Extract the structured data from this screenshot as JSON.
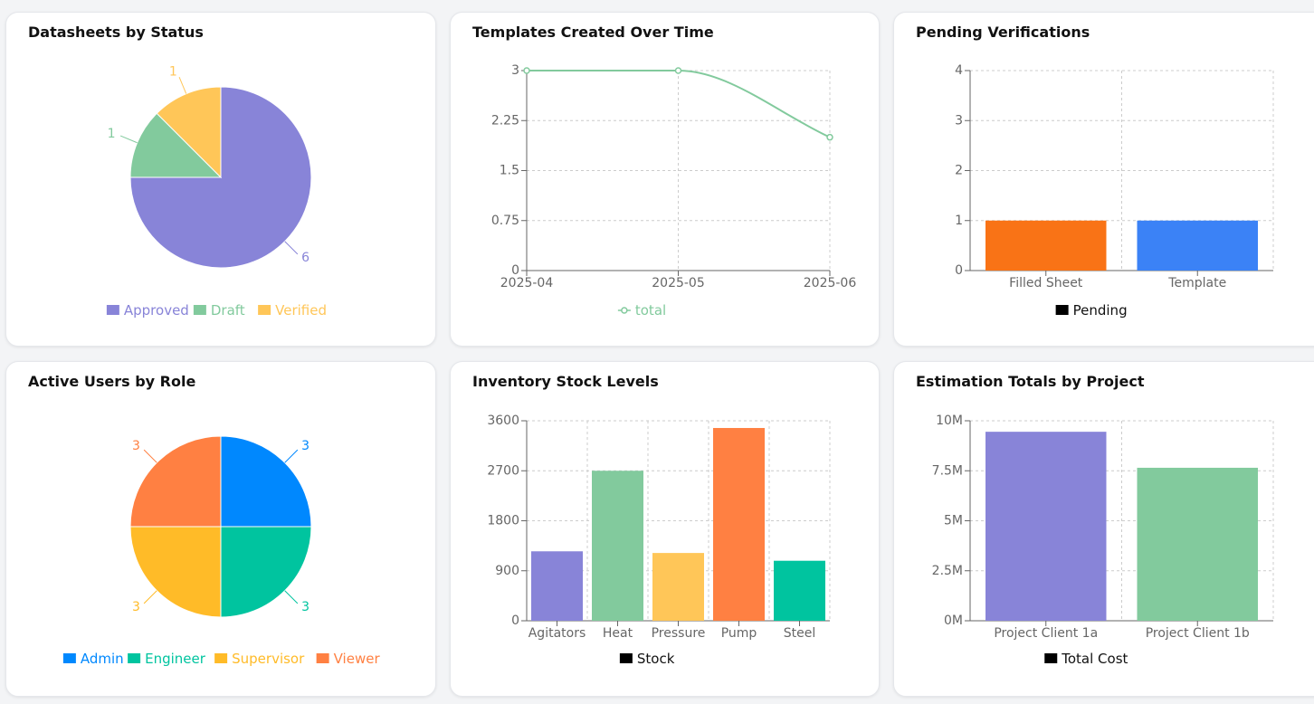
{
  "charts": [
    {
      "title": "Datasheets by Status",
      "chart_data": {
        "type": "pie",
        "labels": [
          "Approved",
          "Draft",
          "Verified"
        ],
        "values": [
          6,
          1,
          1
        ],
        "colors": [
          "#8884d8",
          "#82ca9d",
          "#ffc658"
        ],
        "legend": "bottom"
      }
    },
    {
      "title": "Templates Created Over Time",
      "chart_data": {
        "type": "line",
        "x": [
          "2025-04",
          "2025-05",
          "2025-06"
        ],
        "series": [
          {
            "name": "total",
            "values": [
              3,
              3,
              2
            ],
            "color": "#82ca9d"
          }
        ],
        "yticks": [
          "0",
          "0.75",
          "1.5",
          "2.25",
          "3"
        ],
        "ylim": [
          0,
          3
        ],
        "grid": true,
        "legend": "bottom"
      }
    },
    {
      "title": "Pending Verifications",
      "chart_data": {
        "type": "bar",
        "categories": [
          "Filled Sheet",
          "Template"
        ],
        "series": [
          {
            "name": "Pending",
            "values": [
              1,
              1
            ]
          }
        ],
        "colors": [
          "#f97316",
          "#3b82f6"
        ],
        "yticks": [
          "0",
          "1",
          "2",
          "3",
          "4"
        ],
        "ylim": [
          0,
          4
        ],
        "grid": true,
        "legend": "bottom"
      }
    },
    {
      "title": "Active Users by Role",
      "chart_data": {
        "type": "pie",
        "labels": [
          "Admin",
          "Engineer",
          "Supervisor",
          "Viewer"
        ],
        "values": [
          3,
          3,
          3,
          3
        ],
        "colors": [
          "#0088fe",
          "#00c49f",
          "#ffbb28",
          "#ff8042"
        ],
        "legend": "bottom"
      }
    },
    {
      "title": "Inventory Stock Levels",
      "chart_data": {
        "type": "bar",
        "categories": [
          "Agitators",
          "Heat",
          "Pressure",
          "Pump",
          "Steel"
        ],
        "series": [
          {
            "name": "Stock",
            "values": [
              1250,
              2700,
              1220,
              3470,
              1080
            ]
          }
        ],
        "colors": [
          "#8884d8",
          "#82ca9d",
          "#ffc658",
          "#ff8042",
          "#00c49f"
        ],
        "yticks": [
          "0",
          "900",
          "1800",
          "2700",
          "3600"
        ],
        "ylim": [
          0,
          3600
        ],
        "grid": true,
        "legend": "bottom"
      }
    },
    {
      "title": "Estimation Totals by Project",
      "chart_data": {
        "type": "bar",
        "categories": [
          "Project Client 1a",
          "Project Client 1b"
        ],
        "series": [
          {
            "name": "Total Cost",
            "values": [
              9450000,
              7650000
            ]
          }
        ],
        "colors": [
          "#8884d8",
          "#82ca9d"
        ],
        "yticks": [
          "0M",
          "2.5M",
          "5M",
          "7.5M",
          "10M"
        ],
        "ylim": [
          0,
          10000000
        ],
        "grid": true,
        "legend": "bottom"
      }
    }
  ]
}
